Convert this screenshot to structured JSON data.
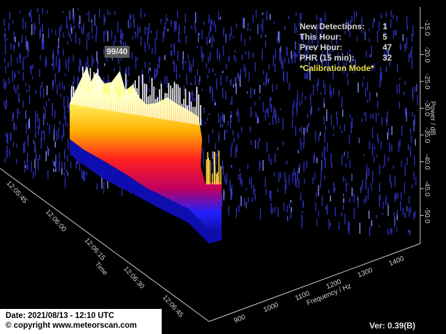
{
  "stats": {
    "rows": [
      {
        "label": "New Detections:",
        "value": "1"
      },
      {
        "label": "This Hour:",
        "value": "5"
      },
      {
        "label": "Prev Hour:",
        "value": "47"
      },
      {
        "label": "PHR (15 min):",
        "value": "32"
      }
    ],
    "mode": "*Calibration Mode*"
  },
  "counter": "99/40",
  "footer": {
    "date": "Date: 2021/08/13 - 12:10 UTC",
    "copyright": "© copyright www.meteorscan.com"
  },
  "version": "Ver: 0.39(B)",
  "colors": {
    "background": "#000000",
    "axis": "#d0d0d0",
    "stats_text": "#d8d8d8",
    "mode_text": "#e8e04a",
    "noise": "#2b2fb5",
    "signal_low": "#1a1aff",
    "signal_mid": "#ff2020",
    "signal_high": "#ffff60",
    "signal_peak": "#ffffff"
  },
  "axes": {
    "time": {
      "label": "Time",
      "ticks": [
        "12:05:45",
        "12:06:00",
        "12:06:15",
        "12:06:30",
        "12:06:45"
      ]
    },
    "frequency": {
      "label": "Frequency / Hz",
      "ticks": [
        "900",
        "1000",
        "1100",
        "1200",
        "1300",
        "1400"
      ]
    },
    "power": {
      "label": "Power / dB",
      "ticks": [
        "-15.0",
        "-20.0",
        "-25.0",
        "-30.0",
        "-35.0",
        "-40.0",
        "-45.0",
        "-50.0"
      ]
    }
  }
}
